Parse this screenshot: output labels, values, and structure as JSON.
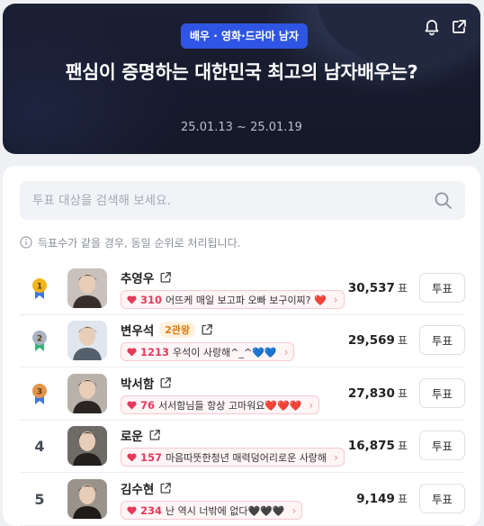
{
  "header": {
    "category": "배우 · 영화·드라마 남자",
    "title": "팬심이 증명하는 대한민국 최고의 남자배우는?",
    "date_range": "25.01.13 ~ 25.01.19"
  },
  "search": {
    "placeholder": "투표 대상을 검색해 보세요."
  },
  "notice": "득표수가 같을 경우, 동일 순위로 처리됩니다.",
  "vote_unit": "표",
  "vote_button": "투표",
  "rankings": [
    {
      "rank": "1",
      "name": "추영우",
      "badge": "",
      "cheer_count": "310",
      "cheer_msg": "어뜨케 매일 보고파 오빠 보구이찌? ❤️",
      "votes": "30,537",
      "medal": "gold"
    },
    {
      "rank": "2",
      "name": "변우석",
      "badge": "2관왕",
      "cheer_count": "1213",
      "cheer_msg": "우석이 사랑해^_^💙💙",
      "votes": "29,569",
      "medal": "silver"
    },
    {
      "rank": "3",
      "name": "박서함",
      "badge": "",
      "cheer_count": "76",
      "cheer_msg": "서서함님들 항상 고마워요❤️❤️❤️",
      "votes": "27,830",
      "medal": "bronze"
    },
    {
      "rank": "4",
      "name": "로운",
      "badge": "",
      "cheer_count": "157",
      "cheer_msg": "마음따뜻한청년 매력덩어리로운 사랑해",
      "votes": "16,875",
      "medal": ""
    },
    {
      "rank": "5",
      "name": "김수현",
      "badge": "",
      "cheer_count": "234",
      "cheer_msg": "난 역시 너밖에 없다🖤🖤🖤",
      "votes": "9,149",
      "medal": ""
    }
  ],
  "colors": {
    "accent": "#2f55e4",
    "cheer": "#e53a5a",
    "gold": "#f2b61b",
    "silver": "#aab3c2",
    "bronze": "#e3944a"
  }
}
